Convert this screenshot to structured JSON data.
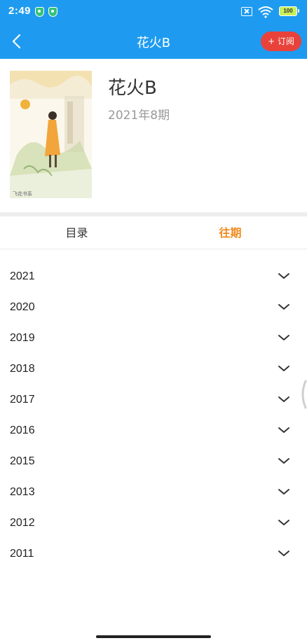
{
  "status_bar": {
    "time": "2:49",
    "battery_level": "100",
    "icons": [
      "shield-icon",
      "shield-icon",
      "sim-off-icon",
      "wifi-icon",
      "battery-icon"
    ]
  },
  "nav": {
    "title": "花火B",
    "back_icon": "chevron-left-icon",
    "subscribe_label": "+ 订阅"
  },
  "magazine": {
    "title": "花火B",
    "issue": "2021年8期"
  },
  "tabs": [
    {
      "label": "目录",
      "active": false
    },
    {
      "label": "往期",
      "active": true
    }
  ],
  "years": [
    {
      "label": "2021"
    },
    {
      "label": "2020"
    },
    {
      "label": "2019"
    },
    {
      "label": "2018"
    },
    {
      "label": "2017"
    },
    {
      "label": "2016"
    },
    {
      "label": "2015"
    },
    {
      "label": "2013"
    },
    {
      "label": "2012"
    },
    {
      "label": "2011"
    }
  ],
  "colors": {
    "primary": "#1e9bf0",
    "subscribe": "#e8423a",
    "active_tab": "#f08a1c",
    "muted_text": "#9a9a9a"
  }
}
